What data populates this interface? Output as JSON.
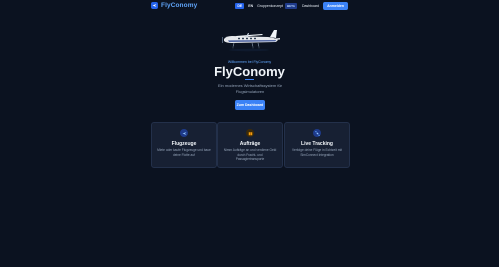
{
  "header": {
    "brand": "FlyConomy",
    "lang_de": "DE",
    "lang_en": "EN",
    "nav_link": "Gruppenkonzept",
    "beta": "BETA",
    "dashboard": "Dashboard",
    "login": "Anmelden"
  },
  "hero": {
    "welcome": "Willkommen bei FlyConomy",
    "title": "FlyConomy",
    "subtitle": "Ein modernes Wirtschaftssystem für Flugsimulatoren",
    "cta": "Zum Dashboard"
  },
  "features": [
    {
      "title": "Flugzeuge",
      "desc": "Miete oder kaufe Flugzeuge und baue deine Flotte auf",
      "icon": "airplane-icon",
      "color": "#3b82f6"
    },
    {
      "title": "Aufträge",
      "desc": "Nimm Aufträge an und verdiene Geld durch Fracht- und Passagiertransporte",
      "icon": "package-icon",
      "color": "#f59e0b"
    },
    {
      "title": "Live Tracking",
      "desc": "Verfolge deine Flüge in Echtzeit mit SimConnect Integration",
      "icon": "satellite-icon",
      "color": "#60a5fa"
    }
  ]
}
